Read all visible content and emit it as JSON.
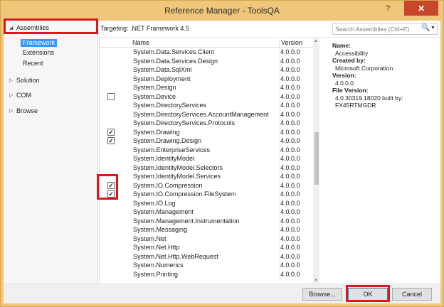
{
  "window": {
    "title": "Reference Manager - ToolsQA",
    "help_glyph": "?",
    "close_glyph": "✕"
  },
  "leftpane": {
    "assemblies": "Assemblies",
    "framework": "Framework",
    "extensions": "Extensions",
    "recent": "Recent",
    "solution": "Solution",
    "com": "COM",
    "browse": "Browse"
  },
  "topbar": {
    "targeting": "Targeting: .NET Framework 4.5",
    "search_placeholder": "Search Assemblies (Ctrl+E)"
  },
  "list": {
    "columns": {
      "name": "Name",
      "version": "Version"
    },
    "rows": [
      {
        "name": "System.Data.Services.Client",
        "version": "4.0.0.0",
        "checkbox": "none"
      },
      {
        "name": "System.Data.Services.Design",
        "version": "4.0.0.0",
        "checkbox": "none"
      },
      {
        "name": "System.Data.SqlXml",
        "version": "4.0.0.0",
        "checkbox": "none"
      },
      {
        "name": "System.Deployment",
        "version": "4.0.0.0",
        "checkbox": "none"
      },
      {
        "name": "System.Design",
        "version": "4.0.0.0",
        "checkbox": "none"
      },
      {
        "name": "System.Device",
        "version": "4.0.0.0",
        "checkbox": "unchecked"
      },
      {
        "name": "System.DirectoryServices",
        "version": "4.0.0.0",
        "checkbox": "none"
      },
      {
        "name": "System.DirectoryServices.AccountManagement",
        "version": "4.0.0.0",
        "checkbox": "none"
      },
      {
        "name": "System.DirectoryServices.Protocols",
        "version": "4.0.0.0",
        "checkbox": "none"
      },
      {
        "name": "System.Drawing",
        "version": "4.0.0.0",
        "checkbox": "checked"
      },
      {
        "name": "System.Drawing.Design",
        "version": "4.0.0.0",
        "checkbox": "checked"
      },
      {
        "name": "System.EnterpriseServices",
        "version": "4.0.0.0",
        "checkbox": "none"
      },
      {
        "name": "System.IdentityModel",
        "version": "4.0.0.0",
        "checkbox": "none"
      },
      {
        "name": "System.IdentityModel.Selectors",
        "version": "4.0.0.0",
        "checkbox": "none"
      },
      {
        "name": "System.IdentityModel.Services",
        "version": "4.0.0.0",
        "checkbox": "none"
      },
      {
        "name": "System.IO.Compression",
        "version": "4.0.0.0",
        "checkbox": "checked"
      },
      {
        "name": "System.IO.Compression.FileSystem",
        "version": "4.0.0.0",
        "checkbox": "checked"
      },
      {
        "name": "System.IO.Log",
        "version": "4.0.0.0",
        "checkbox": "none"
      },
      {
        "name": "System.Management",
        "version": "4.0.0.0",
        "checkbox": "none"
      },
      {
        "name": "System.Management.Instrumentation",
        "version": "4.0.0.0",
        "checkbox": "none"
      },
      {
        "name": "System.Messaging",
        "version": "4.0.0.0",
        "checkbox": "none"
      },
      {
        "name": "System.Net",
        "version": "4.0.0.0",
        "checkbox": "none"
      },
      {
        "name": "System.Net.Http",
        "version": "4.0.0.0",
        "checkbox": "none"
      },
      {
        "name": "System.Net.Http.WebRequest",
        "version": "4.0.0.0",
        "checkbox": "none"
      },
      {
        "name": "System.Numerics",
        "version": "4.0.0.0",
        "checkbox": "none"
      },
      {
        "name": "System.Printing",
        "version": "4.0.0.0",
        "checkbox": "none"
      }
    ]
  },
  "details": {
    "name_label": "Name:",
    "name_value": "Accessibility",
    "created_label": "Created by:",
    "created_value": "Microsoft Corporation",
    "version_label": "Version:",
    "version_value": "4.0.0.0",
    "file_version_label": "File Version:",
    "file_version_line1": "4.0.30319.18020 built by:",
    "file_version_line2": "FX45RTMGDR"
  },
  "buttons": {
    "browse": "Browse...",
    "ok": "OK",
    "cancel": "Cancel"
  },
  "icons": {
    "check": "✓",
    "search": "🔍",
    "dropdown": "▼",
    "expanded": "◢",
    "collapsed": "▷",
    "scroll_up": "▲",
    "scroll_down": "▼"
  },
  "colors": {
    "frame": "#f0c77a",
    "selection": "#3399ff",
    "highlight_box": "#e0141e",
    "close_button": "#c7472b"
  }
}
